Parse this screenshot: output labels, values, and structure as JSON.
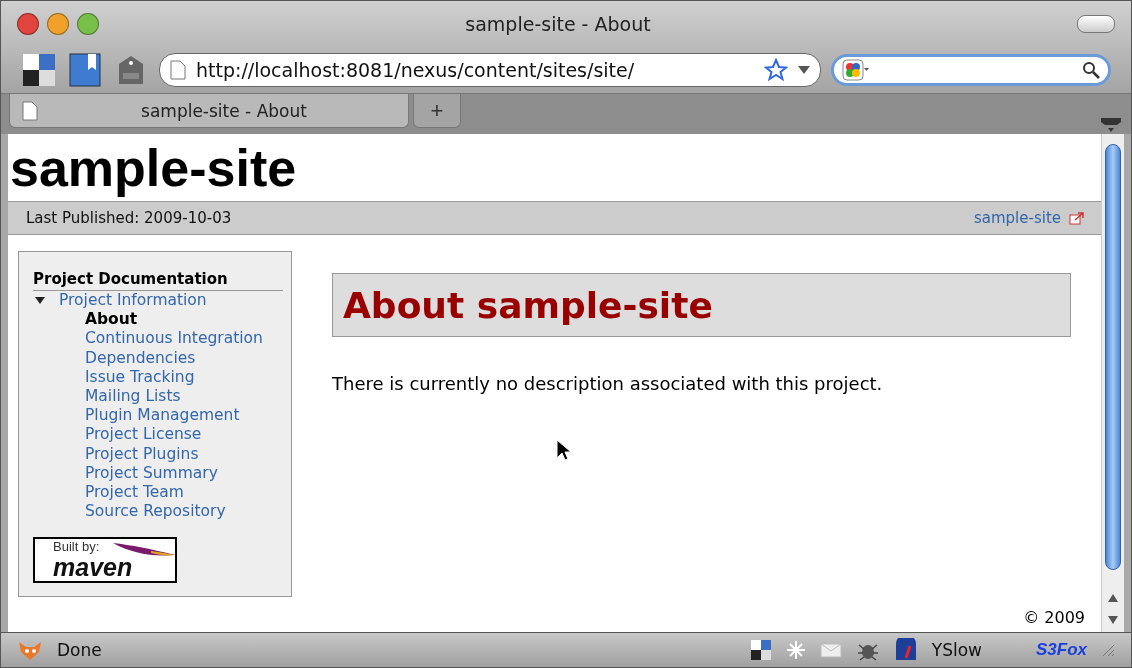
{
  "window": {
    "title": "sample-site - About"
  },
  "toolbar": {
    "url": "http://localhost:8081/nexus/content/sites/site/"
  },
  "tabs": [
    {
      "label": "sample-site - About",
      "selected": true
    }
  ],
  "new_tab": "+",
  "page": {
    "site_title": "sample-site",
    "banner": {
      "published": "Last Published: 2009-10-03",
      "link": "sample-site"
    },
    "sidebar": {
      "heading": "Project Documentation",
      "items": [
        {
          "label": "Project Information",
          "expanded": true,
          "children": [
            {
              "label": "About",
              "selected": true
            },
            {
              "label": "Continuous Integration",
              "selected": false
            },
            {
              "label": "Dependencies",
              "selected": false
            },
            {
              "label": "Issue Tracking",
              "selected": false
            },
            {
              "label": "Mailing Lists",
              "selected": false
            },
            {
              "label": "Plugin Management",
              "selected": false
            },
            {
              "label": "Project License",
              "selected": false
            },
            {
              "label": "Project Plugins",
              "selected": false
            },
            {
              "label": "Project Summary",
              "selected": false
            },
            {
              "label": "Project Team",
              "selected": false
            },
            {
              "label": "Source Repository",
              "selected": false
            }
          ]
        }
      ]
    },
    "badge": {
      "caption": "Built by:",
      "name": "maven"
    },
    "heading": "About sample-site",
    "text": "There is currently no description associated with this project.",
    "footer": "© 2009"
  },
  "status_bar": {
    "status": "Done",
    "items": [
      {
        "kind": "text",
        "label": "YSlow"
      },
      {
        "kind": "brand",
        "label": "S3Fox"
      }
    ]
  }
}
